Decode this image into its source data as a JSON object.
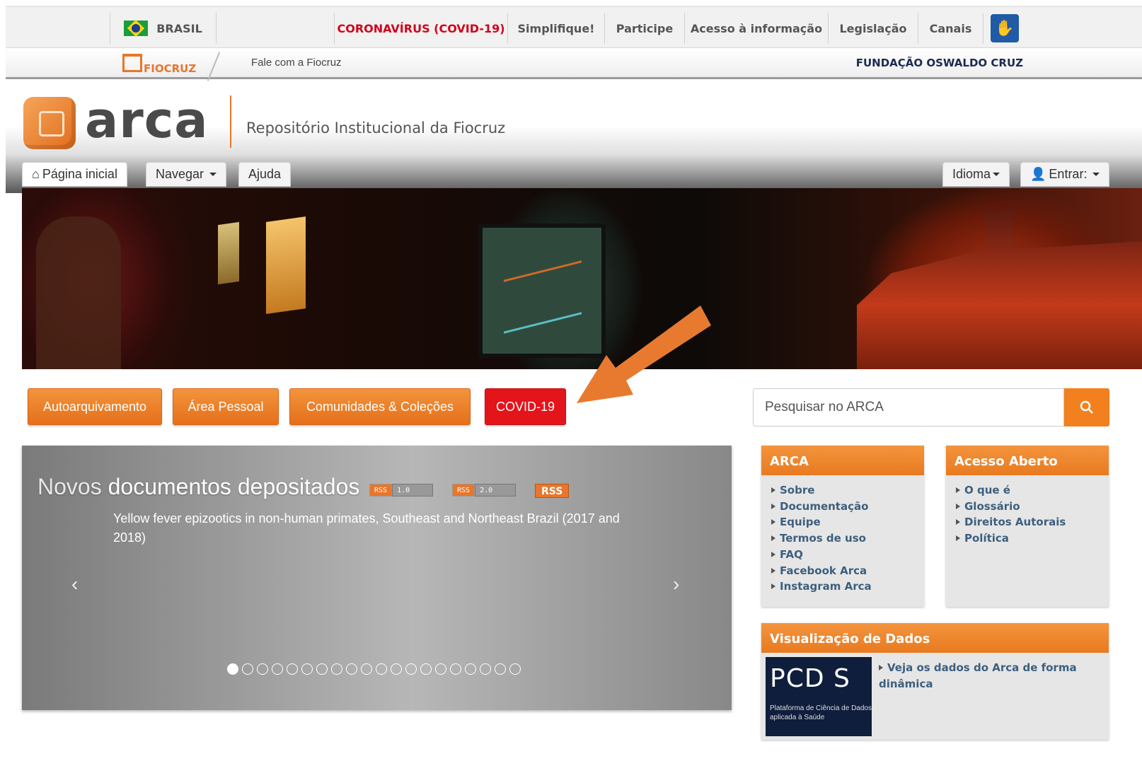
{
  "gov_bar": {
    "country": "BRASIL",
    "links": [
      "CORONAVÍRUS (COVID-19)",
      "Simplifique!",
      "Participe",
      "Acesso à informação",
      "Legislação",
      "Canais"
    ],
    "covid_color": "#d0021b",
    "accessibility_icon": "hand-sign-icon"
  },
  "fiocruz_bar": {
    "logo_text": "FIOCRUZ",
    "contact_link": "Fale com a Fiocruz",
    "foundation_name": "FUNDAÇÃO OSWALDO CRUZ"
  },
  "header": {
    "logo_word": "arca",
    "subtitle": "Repositório Institucional da Fiocruz"
  },
  "nav": {
    "home": "Página inicial",
    "browse": "Navegar",
    "help": "Ajuda",
    "language": "Idioma",
    "login": "Entrar:"
  },
  "actions": {
    "self_archive": "Autoarquivamento",
    "personal_area": "Área Pessoal",
    "communities": "Comunidades & Coleções",
    "covid": "COVID-19"
  },
  "search": {
    "placeholder": "Pesquisar no ARCA"
  },
  "carousel": {
    "title_light": "Novos",
    "title_bold": "documentos depositados",
    "rss_badges": [
      {
        "left": "RSS",
        "right": "1.0"
      },
      {
        "left": "RSS",
        "right": "2.0"
      }
    ],
    "rss_label": "RSS",
    "document": "Yellow fever epizootics in non-human primates, Southeast and Northeast Brazil (2017 and 2018)",
    "prev": "‹",
    "next": "›",
    "slide_count": 20,
    "active_slide": 1
  },
  "arca_panel": {
    "title": "ARCA",
    "items": [
      "Sobre",
      "Documentação",
      "Equipe",
      "Termos de uso",
      "FAQ",
      "Facebook Arca",
      "Instagram Arca"
    ]
  },
  "open_access_panel": {
    "title": "Acesso Aberto",
    "items": [
      "O que é",
      "Glossário",
      "Direitos Autorais",
      "Política"
    ]
  },
  "data_panel": {
    "title": "Visualização de Dados",
    "logo_big": "PCD S",
    "logo_small": "Plataforma de Ciência de Dados aplicada à Saúde",
    "link": "Veja os dados do Arca de forma dinâmica"
  },
  "colors": {
    "accent_orange": "#e8762c",
    "covid_red": "#e4141b",
    "link_blue": "#3d5f7e",
    "arrow": "#e87a30"
  }
}
